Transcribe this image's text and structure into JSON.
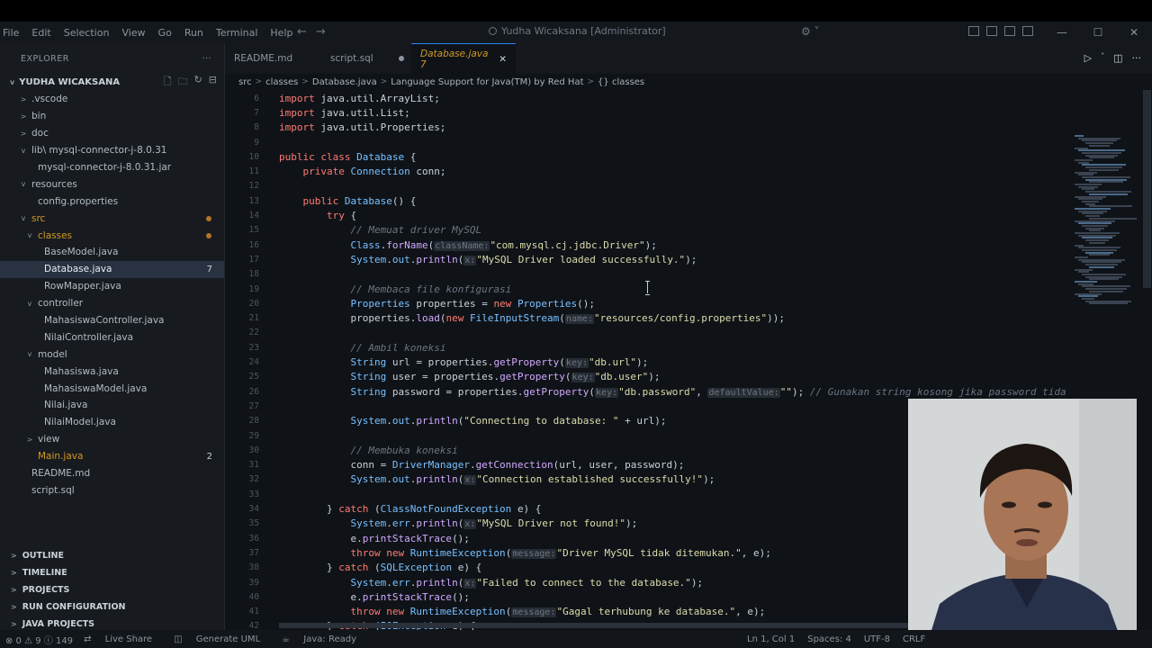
{
  "window": {
    "menu": [
      "File",
      "Edit",
      "Selection",
      "View",
      "Go",
      "Run",
      "Terminal",
      "Help"
    ],
    "search_text": "Yudha Wicaksana [Administrator]"
  },
  "sidebar": {
    "title": "EXPLORER",
    "root": "YUDHA WICAKSANA",
    "tree": [
      {
        "label": ".vscode",
        "indent": 1,
        "chev": ">"
      },
      {
        "label": "bin",
        "indent": 1,
        "chev": ">"
      },
      {
        "label": "doc",
        "indent": 1,
        "chev": ">"
      },
      {
        "label": "lib\\ mysql-connector-j-8.0.31",
        "indent": 1,
        "chev": "v"
      },
      {
        "label": "mysql-connector-j-8.0.31.jar",
        "indent": 2,
        "chev": ""
      },
      {
        "label": "resources",
        "indent": 1,
        "chev": "v"
      },
      {
        "label": "config.properties",
        "indent": 2,
        "chev": ""
      },
      {
        "label": "src",
        "indent": 1,
        "chev": "v",
        "dot": true,
        "mod": true
      },
      {
        "label": "classes",
        "indent": 2,
        "chev": "v",
        "dot": true,
        "mod": true
      },
      {
        "label": "BaseModel.java",
        "indent": 3,
        "chev": ""
      },
      {
        "label": "Database.java",
        "indent": 3,
        "chev": "",
        "badge": "7",
        "selected": true
      },
      {
        "label": "RowMapper.java",
        "indent": 3,
        "chev": ""
      },
      {
        "label": "controller",
        "indent": 2,
        "chev": "v"
      },
      {
        "label": "MahasiswaController.java",
        "indent": 3,
        "chev": ""
      },
      {
        "label": "NilaiController.java",
        "indent": 3,
        "chev": ""
      },
      {
        "label": "model",
        "indent": 2,
        "chev": "v"
      },
      {
        "label": "Mahasiswa.java",
        "indent": 3,
        "chev": ""
      },
      {
        "label": "MahasiswaModel.java",
        "indent": 3,
        "chev": ""
      },
      {
        "label": "Nilai.java",
        "indent": 3,
        "chev": ""
      },
      {
        "label": "NilaiModel.java",
        "indent": 3,
        "chev": ""
      },
      {
        "label": "view",
        "indent": 2,
        "chev": ">"
      },
      {
        "label": "Main.java",
        "indent": 2,
        "chev": "",
        "badge": "2",
        "mod": true
      },
      {
        "label": "README.md",
        "indent": 1,
        "chev": ""
      },
      {
        "label": "script.sql",
        "indent": 1,
        "chev": ""
      }
    ],
    "sections": [
      "OUTLINE",
      "TIMELINE",
      "PROJECTS",
      "RUN CONFIGURATION",
      "JAVA PROJECTS"
    ]
  },
  "tabs": [
    {
      "label": "README.md"
    },
    {
      "label": "script.sql"
    },
    {
      "label": "Database.java 7",
      "active": true
    }
  ],
  "breadcrumb": [
    "src",
    "classes",
    "Database.java",
    "Language Support for Java(TM) by Red Hat",
    "{} classes"
  ],
  "code": [
    {
      "n": "6",
      "t": [
        [
          "kw",
          "import "
        ],
        [
          "src",
          "java.util.ArrayList;"
        ]
      ]
    },
    {
      "n": "7",
      "t": [
        [
          "kw",
          "import "
        ],
        [
          "src",
          "java.util.List;"
        ]
      ]
    },
    {
      "n": "8",
      "t": [
        [
          "kw",
          "import "
        ],
        [
          "src",
          "java.util.Properties;"
        ]
      ]
    },
    {
      "n": "9",
      "t": []
    },
    {
      "n": "10",
      "t": [
        [
          "kw",
          "public class "
        ],
        [
          "ty",
          "Database "
        ],
        [
          "src",
          "{"
        ]
      ]
    },
    {
      "n": "11",
      "t": [
        [
          "src",
          "    "
        ],
        [
          "kw",
          "private "
        ],
        [
          "ty",
          "Connection "
        ],
        [
          "src",
          "conn;"
        ]
      ]
    },
    {
      "n": "12",
      "t": []
    },
    {
      "n": "13",
      "t": [
        [
          "src",
          "    "
        ],
        [
          "kw",
          "public "
        ],
        [
          "ty",
          "Database"
        ],
        [
          "src",
          "() {"
        ]
      ]
    },
    {
      "n": "14",
      "t": [
        [
          "src",
          "        "
        ],
        [
          "kw",
          "try "
        ],
        [
          "src",
          "{"
        ]
      ]
    },
    {
      "n": "15",
      "t": [
        [
          "src",
          "            "
        ],
        [
          "cm",
          "// Memuat driver MySQL"
        ]
      ]
    },
    {
      "n": "16",
      "t": [
        [
          "src",
          "            "
        ],
        [
          "ty",
          "Class"
        ],
        [
          "src",
          "."
        ],
        [
          "fn",
          "forName"
        ],
        [
          "src",
          "("
        ],
        [
          "hint",
          "className:"
        ],
        [
          "st",
          "\"com.mysql.cj.jdbc.Driver\""
        ],
        [
          "src",
          ");"
        ]
      ]
    },
    {
      "n": "17",
      "t": [
        [
          "src",
          "            "
        ],
        [
          "ty",
          "System"
        ],
        [
          "src",
          "."
        ],
        [
          "ty",
          "out"
        ],
        [
          "src",
          "."
        ],
        [
          "fn",
          "println"
        ],
        [
          "src",
          "("
        ],
        [
          "hint",
          "x:"
        ],
        [
          "st",
          "\"MySQL Driver loaded successfully.\""
        ],
        [
          "src",
          ");"
        ]
      ]
    },
    {
      "n": "18",
      "t": []
    },
    {
      "n": "19",
      "t": [
        [
          "src",
          "            "
        ],
        [
          "cm",
          "// Membaca file konfigurasi"
        ]
      ]
    },
    {
      "n": "20",
      "t": [
        [
          "src",
          "            "
        ],
        [
          "ty",
          "Properties "
        ],
        [
          "src",
          "properties = "
        ],
        [
          "kw",
          "new "
        ],
        [
          "ty",
          "Properties"
        ],
        [
          "src",
          "();"
        ]
      ]
    },
    {
      "n": "21",
      "t": [
        [
          "src",
          "            properties."
        ],
        [
          "fn",
          "load"
        ],
        [
          "src",
          "("
        ],
        [
          "kw",
          "new "
        ],
        [
          "ty",
          "FileInputStream"
        ],
        [
          "src",
          "("
        ],
        [
          "hint",
          "name:"
        ],
        [
          "st",
          "\"resources/config.properties\""
        ],
        [
          "src",
          "));"
        ]
      ]
    },
    {
      "n": "22",
      "t": []
    },
    {
      "n": "23",
      "t": [
        [
          "src",
          "            "
        ],
        [
          "cm",
          "// Ambil koneksi"
        ]
      ]
    },
    {
      "n": "24",
      "t": [
        [
          "src",
          "            "
        ],
        [
          "ty",
          "String "
        ],
        [
          "src",
          "url = properties."
        ],
        [
          "fn",
          "getProperty"
        ],
        [
          "src",
          "("
        ],
        [
          "hint",
          "key:"
        ],
        [
          "st",
          "\"db.url\""
        ],
        [
          "src",
          ");"
        ]
      ]
    },
    {
      "n": "25",
      "t": [
        [
          "src",
          "            "
        ],
        [
          "ty",
          "String "
        ],
        [
          "src",
          "user = properties."
        ],
        [
          "fn",
          "getProperty"
        ],
        [
          "src",
          "("
        ],
        [
          "hint",
          "key:"
        ],
        [
          "st",
          "\"db.user\""
        ],
        [
          "src",
          ");"
        ]
      ]
    },
    {
      "n": "26",
      "t": [
        [
          "src",
          "            "
        ],
        [
          "ty",
          "String "
        ],
        [
          "src",
          "password = properties."
        ],
        [
          "fn",
          "getProperty"
        ],
        [
          "src",
          "("
        ],
        [
          "hint",
          "key:"
        ],
        [
          "st",
          "\"db.password\""
        ],
        [
          "src",
          ", "
        ],
        [
          "hint",
          "defaultValue:"
        ],
        [
          "st",
          "\"\""
        ],
        [
          "src",
          "); "
        ],
        [
          "cm",
          "// Gunakan string kosong jika password tida"
        ]
      ]
    },
    {
      "n": "27",
      "t": []
    },
    {
      "n": "28",
      "t": [
        [
          "src",
          "            "
        ],
        [
          "ty",
          "System"
        ],
        [
          "src",
          "."
        ],
        [
          "ty",
          "out"
        ],
        [
          "src",
          "."
        ],
        [
          "fn",
          "println"
        ],
        [
          "src",
          "("
        ],
        [
          "st",
          "\"Connecting to database: \" "
        ],
        [
          "src",
          "+ url);"
        ]
      ]
    },
    {
      "n": "29",
      "t": []
    },
    {
      "n": "30",
      "t": [
        [
          "src",
          "            "
        ],
        [
          "cm",
          "// Membuka koneksi"
        ]
      ]
    },
    {
      "n": "31",
      "t": [
        [
          "src",
          "            conn = "
        ],
        [
          "ty",
          "DriverManager"
        ],
        [
          "src",
          "."
        ],
        [
          "fn",
          "getConnection"
        ],
        [
          "src",
          "(url, user, password);"
        ]
      ]
    },
    {
      "n": "32",
      "t": [
        [
          "src",
          "            "
        ],
        [
          "ty",
          "System"
        ],
        [
          "src",
          "."
        ],
        [
          "ty",
          "out"
        ],
        [
          "src",
          "."
        ],
        [
          "fn",
          "println"
        ],
        [
          "src",
          "("
        ],
        [
          "hint",
          "x:"
        ],
        [
          "st",
          "\"Connection established successfully!\""
        ],
        [
          "src",
          ");"
        ]
      ]
    },
    {
      "n": "33",
      "t": []
    },
    {
      "n": "34",
      "t": [
        [
          "src",
          "        } "
        ],
        [
          "kw",
          "catch "
        ],
        [
          "src",
          "("
        ],
        [
          "ty",
          "ClassNotFoundException "
        ],
        [
          "src",
          "e) {"
        ]
      ]
    },
    {
      "n": "35",
      "t": [
        [
          "src",
          "            "
        ],
        [
          "ty",
          "System"
        ],
        [
          "src",
          "."
        ],
        [
          "ty",
          "err"
        ],
        [
          "src",
          "."
        ],
        [
          "fn",
          "println"
        ],
        [
          "src",
          "("
        ],
        [
          "hint",
          "x:"
        ],
        [
          "st",
          "\"MySQL Driver not found!\""
        ],
        [
          "src",
          ");"
        ]
      ]
    },
    {
      "n": "36",
      "t": [
        [
          "src",
          "            e."
        ],
        [
          "fn",
          "printStackTrace"
        ],
        [
          "src",
          "();"
        ]
      ]
    },
    {
      "n": "37",
      "t": [
        [
          "src",
          "            "
        ],
        [
          "kw",
          "throw new "
        ],
        [
          "ty",
          "RuntimeException"
        ],
        [
          "src",
          "("
        ],
        [
          "hint",
          "message:"
        ],
        [
          "st",
          "\"Driver MySQL tidak ditemukan.\""
        ],
        [
          "src",
          ", e);"
        ]
      ]
    },
    {
      "n": "38",
      "t": [
        [
          "src",
          "        } "
        ],
        [
          "kw",
          "catch "
        ],
        [
          "src",
          "("
        ],
        [
          "ty",
          "SQLException "
        ],
        [
          "src",
          "e) {"
        ]
      ]
    },
    {
      "n": "39",
      "t": [
        [
          "src",
          "            "
        ],
        [
          "ty",
          "System"
        ],
        [
          "src",
          "."
        ],
        [
          "ty",
          "err"
        ],
        [
          "src",
          "."
        ],
        [
          "fn",
          "println"
        ],
        [
          "src",
          "("
        ],
        [
          "hint",
          "x:"
        ],
        [
          "st",
          "\"Failed to connect to the database.\""
        ],
        [
          "src",
          ");"
        ]
      ]
    },
    {
      "n": "40",
      "t": [
        [
          "src",
          "            e."
        ],
        [
          "fn",
          "printStackTrace"
        ],
        [
          "src",
          "();"
        ]
      ]
    },
    {
      "n": "41",
      "t": [
        [
          "src",
          "            "
        ],
        [
          "kw",
          "throw new "
        ],
        [
          "ty",
          "RuntimeException"
        ],
        [
          "src",
          "("
        ],
        [
          "hint",
          "message:"
        ],
        [
          "st",
          "\"Gagal terhubung ke database.\""
        ],
        [
          "src",
          ", e);"
        ]
      ]
    },
    {
      "n": "42",
      "t": [
        [
          "src",
          "        } "
        ],
        [
          "kw",
          "catch "
        ],
        [
          "src",
          "("
        ],
        [
          "ty",
          "IOException "
        ],
        [
          "src",
          "e) {"
        ]
      ]
    }
  ],
  "status": {
    "problems": "⊗ 0 ⚠ 9 ⓘ 149",
    "live_share": "Live Share",
    "generate_uml": "Generate UML",
    "java": "Java: Ready",
    "position": "Ln 1, Col 1",
    "spaces": "Spaces: 4",
    "encoding": "UTF-8",
    "eol": "CRLF"
  }
}
